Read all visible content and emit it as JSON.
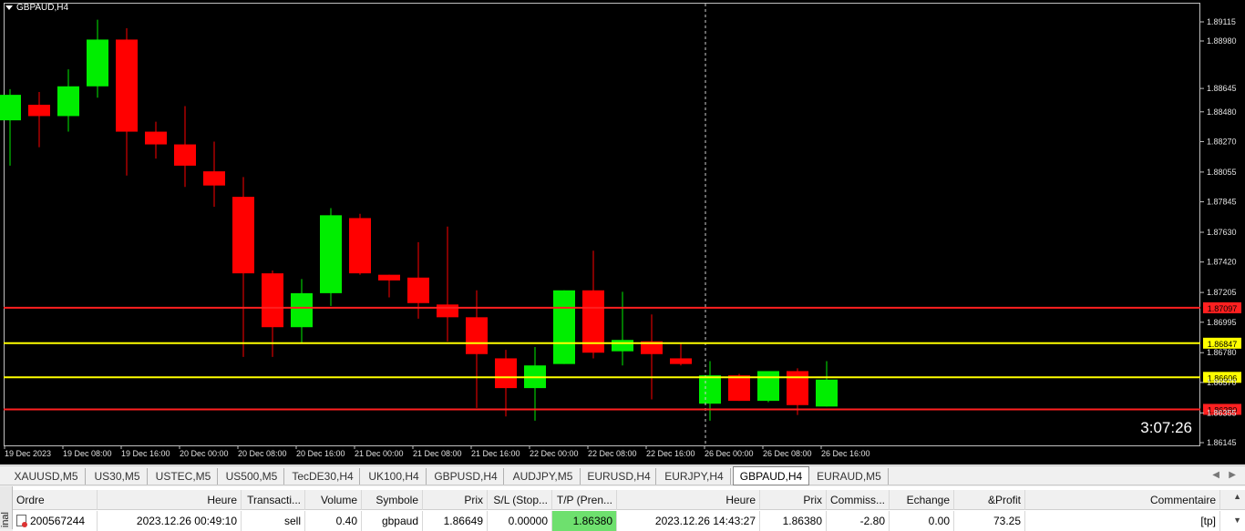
{
  "chart": {
    "symbol_label": "GBPAUD,H4",
    "timer": "3:07:26",
    "colors": {
      "bull": "#00ee00",
      "bear": "#ff0000",
      "wick_bull": "#00ee00",
      "wick_bear": "#ff0000"
    },
    "price_axis": [
      "1.89115",
      "1.88980",
      "1.88645",
      "1.88480",
      "1.88270",
      "1.88055",
      "1.87845",
      "1.87630",
      "1.87420",
      "1.87205",
      "1.86995",
      "1.86780",
      "1.86570",
      "1.86355",
      "1.86145"
    ],
    "time_axis": [
      "19 Dec 2023",
      "19 Dec 08:00",
      "19 Dec 16:00",
      "20 Dec 00:00",
      "20 Dec 08:00",
      "20 Dec 16:00",
      "21 Dec 00:00",
      "21 Dec 08:00",
      "21 Dec 16:00",
      "22 Dec 00:00",
      "22 Dec 08:00",
      "22 Dec 16:00",
      "26 Dec 00:00",
      "26 Dec 08:00",
      "26 Dec 16:00"
    ],
    "levels": [
      {
        "price": "1.87097",
        "color": "#ff2020",
        "label_bg": "#ff2020",
        "label_fg": "#000000"
      },
      {
        "price": "1.86847",
        "color": "#ffff00",
        "label_bg": "#ffff00",
        "label_fg": "#000000"
      },
      {
        "price": "1.86606",
        "color": "#ffff00",
        "label_bg": "#ffff00",
        "label_fg": "#000000"
      },
      {
        "price": "1.86380",
        "color": "#ff2020",
        "label_bg": "#ff2020",
        "label_fg": "#000000"
      }
    ],
    "candles": [
      {
        "o": 1.8842,
        "h": 1.8864,
        "l": 1.881,
        "c": 1.886
      },
      {
        "o": 1.8853,
        "h": 1.8862,
        "l": 1.8823,
        "c": 1.8845
      },
      {
        "o": 1.8845,
        "h": 1.8878,
        "l": 1.8834,
        "c": 1.8866
      },
      {
        "o": 1.8866,
        "h": 1.8913,
        "l": 1.8858,
        "c": 1.8899
      },
      {
        "o": 1.8899,
        "h": 1.8907,
        "l": 1.8803,
        "c": 1.8834
      },
      {
        "o": 1.8834,
        "h": 1.8841,
        "l": 1.8815,
        "c": 1.8825
      },
      {
        "o": 1.8825,
        "h": 1.8852,
        "l": 1.8795,
        "c": 1.881
      },
      {
        "o": 1.8806,
        "h": 1.8827,
        "l": 1.8781,
        "c": 1.8796
      },
      {
        "o": 1.8788,
        "h": 1.8802,
        "l": 1.8675,
        "c": 1.8734
      },
      {
        "o": 1.8734,
        "h": 1.8736,
        "l": 1.8675,
        "c": 1.8696
      },
      {
        "o": 1.8696,
        "h": 1.873,
        "l": 1.8685,
        "c": 1.872
      },
      {
        "o": 1.872,
        "h": 1.878,
        "l": 1.8711,
        "c": 1.8775
      },
      {
        "o": 1.8773,
        "h": 1.8776,
        "l": 1.8733,
        "c": 1.8734
      },
      {
        "o": 1.8733,
        "h": 1.8733,
        "l": 1.8717,
        "c": 1.8729
      },
      {
        "o": 1.8731,
        "h": 1.8756,
        "l": 1.8702,
        "c": 1.8713
      },
      {
        "o": 1.8712,
        "h": 1.8767,
        "l": 1.8686,
        "c": 1.8703
      },
      {
        "o": 1.8703,
        "h": 1.8722,
        "l": 1.8639,
        "c": 1.8677
      },
      {
        "o": 1.8674,
        "h": 1.868,
        "l": 1.8633,
        "c": 1.8653
      },
      {
        "o": 1.8653,
        "h": 1.8682,
        "l": 1.863,
        "c": 1.8669
      },
      {
        "o": 1.867,
        "h": 1.8722,
        "l": 1.867,
        "c": 1.8722
      },
      {
        "o": 1.8722,
        "h": 1.875,
        "l": 1.8674,
        "c": 1.8678
      },
      {
        "o": 1.8679,
        "h": 1.8721,
        "l": 1.8669,
        "c": 1.8687
      },
      {
        "o": 1.8686,
        "h": 1.8705,
        "l": 1.8645,
        "c": 1.8677
      },
      {
        "o": 1.8674,
        "h": 1.8685,
        "l": 1.8669,
        "c": 1.867
      },
      {
        "o": 1.8642,
        "h": 1.8672,
        "l": 1.863,
        "c": 1.8662
      },
      {
        "o": 1.8662,
        "h": 1.8663,
        "l": 1.8644,
        "c": 1.8644
      },
      {
        "o": 1.8644,
        "h": 1.8664,
        "l": 1.8643,
        "c": 1.8665
      },
      {
        "o": 1.8665,
        "h": 1.8667,
        "l": 1.8634,
        "c": 1.8641
      },
      {
        "o": 1.864,
        "h": 1.8672,
        "l": 1.864,
        "c": 1.8659
      }
    ]
  },
  "symbol_tabs": [
    "XAUUSD,M5",
    "US30,M5",
    "USTEC,M5",
    "US500,M5",
    "TecDE30,H4",
    "UK100,H4",
    "GBPUSD,H4",
    "AUDJPY,M5",
    "EURUSD,H4",
    "EURJPY,H4",
    "GBPAUD,H4",
    "EURAUD,M5"
  ],
  "active_tab": "GBPAUD,H4",
  "terminal": {
    "side_label": "inal",
    "headers": [
      "Ordre",
      "Heure",
      "Transacti...",
      "Volume",
      "Symbole",
      "Prix",
      "S/L (Stop...",
      "T/P (Pren...",
      "Heure",
      "Prix",
      "Commiss...",
      "Echange",
      "&Profit",
      "Commentaire"
    ],
    "row": [
      "200567244",
      "2023.12.26 00:49:10",
      "sell",
      "0.40",
      "gbpaud",
      "1.86649",
      "0.00000",
      "1.86380",
      "2023.12.26 14:43:27",
      "1.86380",
      "-2.80",
      "0.00",
      "73.25",
      "[tp]"
    ]
  }
}
